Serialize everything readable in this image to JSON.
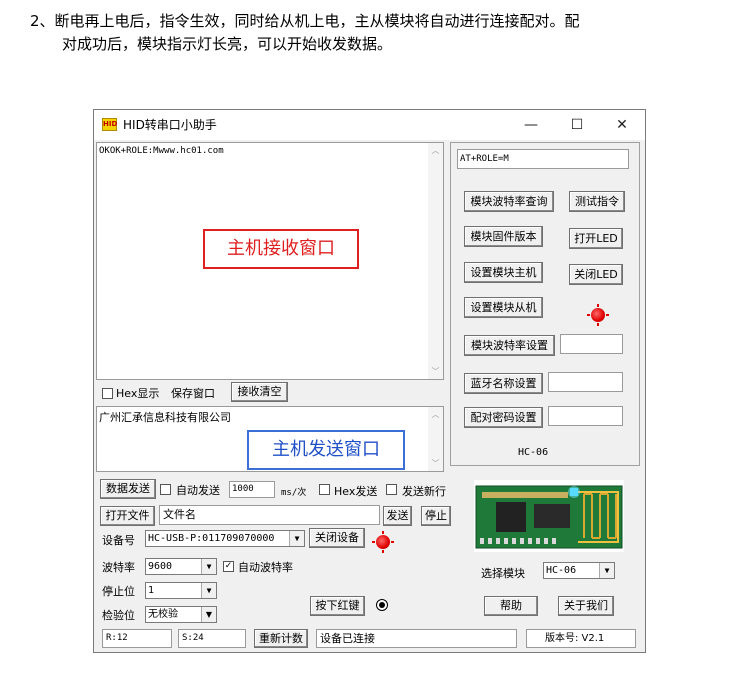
{
  "doc": {
    "line1": "2、断电再上电后，指令生效，同时给从机上电，主从模块将自动进行连接配对。配",
    "line2": "对成功后，模块指示灯长亮，可以开始收发数据。"
  },
  "window": {
    "logo": "HID",
    "title": "HID转串口小助手",
    "minimize": "—",
    "maximize": "☐",
    "close": "✕"
  },
  "receive": {
    "text": "OKOK+ROLE:Mwww.hc01.com",
    "overlay": "主机接收窗口",
    "hex_label": "Hex显示",
    "save_label": "保存窗口",
    "clear_label": "接收清空"
  },
  "send": {
    "text": "广州汇承信息科技有限公司",
    "overlay": "主机发送窗口"
  },
  "right_panel": {
    "at_command": "AT+ROLE=M",
    "btn_baud_query": "模块波特率查询",
    "btn_test_cmd": "测试指令",
    "btn_firmware": "模块固件版本",
    "btn_led_on": "打开LED",
    "btn_set_master": "设置模块主机",
    "btn_led_off": "关闭LED",
    "btn_set_slave": "设置模块从机",
    "btn_baud_set": "模块波特率设置",
    "btn_bt_name": "蓝牙名称设置",
    "btn_pin_set": "配对密码设置",
    "model_label": "HC-06"
  },
  "controls": {
    "data_send": "数据发送",
    "auto_send": "自动发送",
    "interval": "1000",
    "interval_unit": "ms/次",
    "hex_send": "Hex发送",
    "send_newline": "发送新行",
    "open_file": "打开文件",
    "file_name": "文件名",
    "send_btn": "发送",
    "stop_btn": "停止",
    "device_label": "设备号",
    "device_value": "HC-USB-P:011709070000",
    "close_device": "关闭设备",
    "baud_label": "波特率",
    "baud_value": "9600",
    "auto_baud": "自动波特率",
    "stopbit_label": "停止位",
    "stopbit_value": "1",
    "parity_label": "检验位",
    "parity_value": "无校验",
    "press_red_key": "按下红键",
    "select_module": "选择模块",
    "module_value": "HC-06",
    "help": "帮助",
    "about": "关于我们"
  },
  "status": {
    "rx": "R:12",
    "tx": "S:24",
    "reset_count": "重新计数",
    "device_status": "设备已连接",
    "version": "版本号: V2.1"
  },
  "colors": {
    "accent_red": "#e02020",
    "accent_blue": "#2050c8",
    "pcb_green": "#1f7a3a"
  }
}
